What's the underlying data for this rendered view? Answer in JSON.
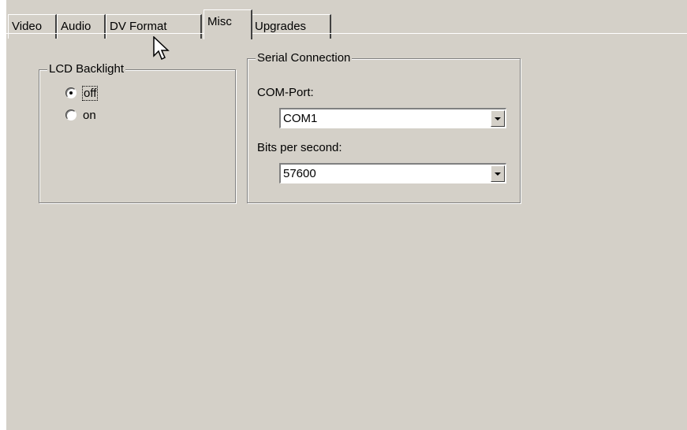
{
  "tabs": [
    {
      "label": "Video",
      "active": false
    },
    {
      "label": "Audio",
      "active": false
    },
    {
      "label": "DV Format",
      "active": false
    },
    {
      "label": "Misc",
      "active": true
    },
    {
      "label": "Upgrades",
      "active": false
    }
  ],
  "lcd_backlight": {
    "title": "LCD Backlight",
    "options": [
      {
        "label": "off",
        "checked": true
      },
      {
        "label": "on",
        "checked": false
      }
    ]
  },
  "serial_connection": {
    "title": "Serial Connection",
    "com_port_label": "COM-Port:",
    "com_port_value": "COM1",
    "bits_label": "Bits per second:",
    "bits_value": "57600"
  },
  "colors": {
    "face": "#d4d0c8",
    "shadow": "#808080",
    "highlight": "#ffffff"
  },
  "icons": {
    "cursor": "mouse-pointer-icon",
    "dropdown": "chevron-down-icon"
  }
}
